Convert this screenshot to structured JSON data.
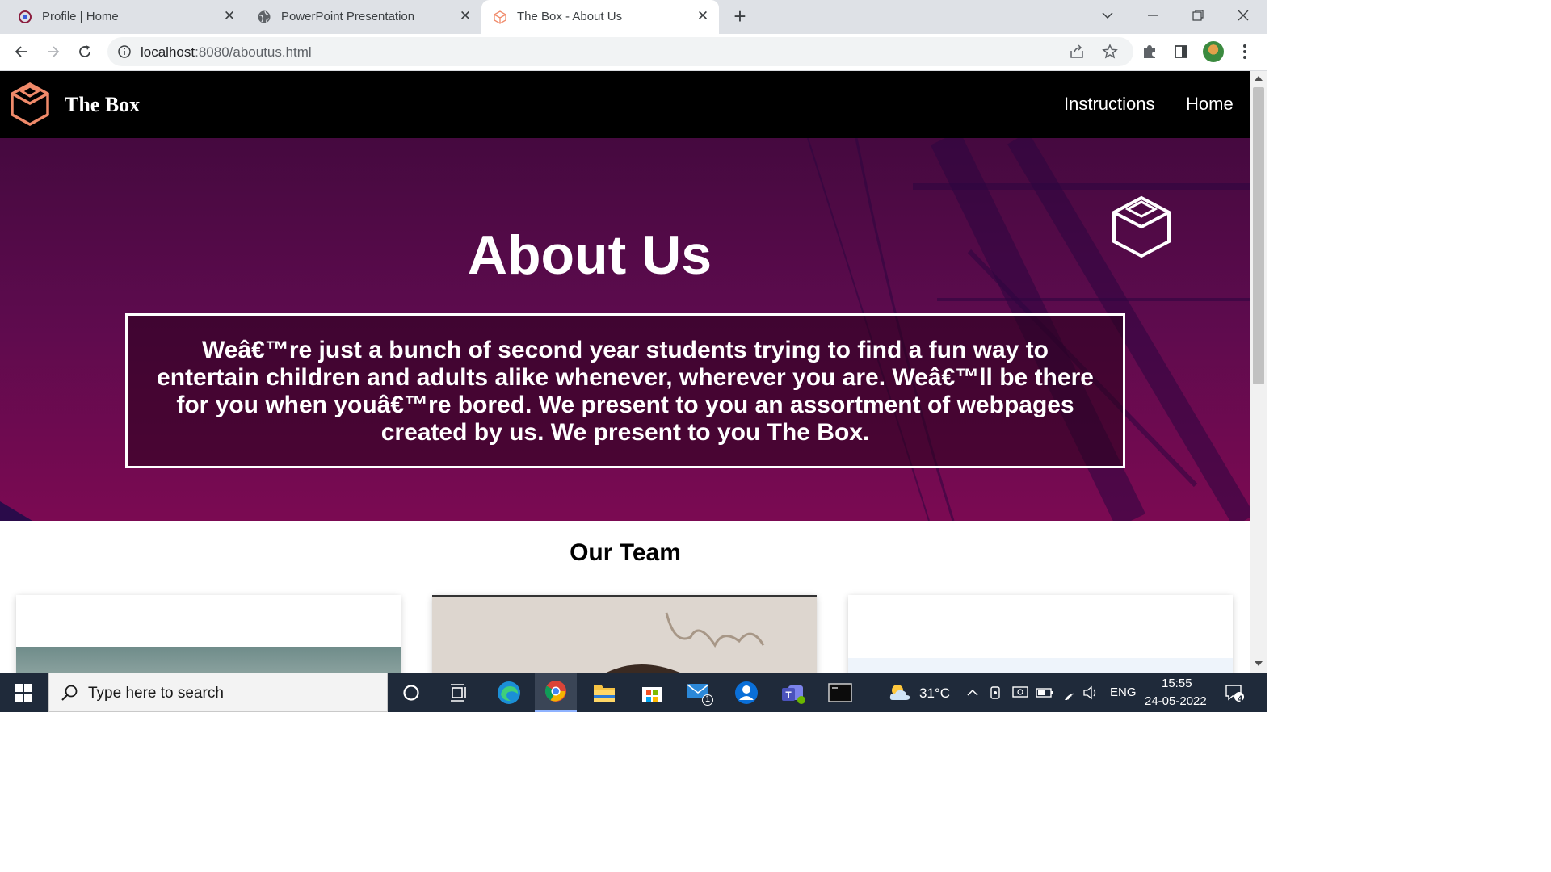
{
  "browser": {
    "tabs": [
      {
        "title": "Profile | Home",
        "active": false
      },
      {
        "title": "PowerPoint Presentation",
        "active": false
      },
      {
        "title": "The Box - About Us",
        "active": true
      }
    ],
    "url_host": "localhost",
    "url_path": ":8080/aboutus.html"
  },
  "site": {
    "brand": "The Box",
    "nav": [
      "Instructions",
      "Home"
    ],
    "hero_title": "About Us",
    "hero_text": "Weâ€™re just a bunch of second year students trying to find a fun way to entertain children and adults alike whenever, wherever you are. Weâ€™ll be there for you when youâ€™re bored. We present to you an assortment of webpages created by us. We present to you The Box.",
    "team_title": "Our Team",
    "colors": {
      "nav_bg": "#000000",
      "hero_top": "#45093f",
      "hero_bottom": "#7b0a52",
      "logo_accent": "#f08a6a"
    }
  },
  "taskbar": {
    "search_placeholder": "Type here to search",
    "weather": "31°C",
    "language": "ENG",
    "time": "15:55",
    "date": "24-05-2022",
    "mail_badge": "1",
    "notification_badge": "4"
  }
}
